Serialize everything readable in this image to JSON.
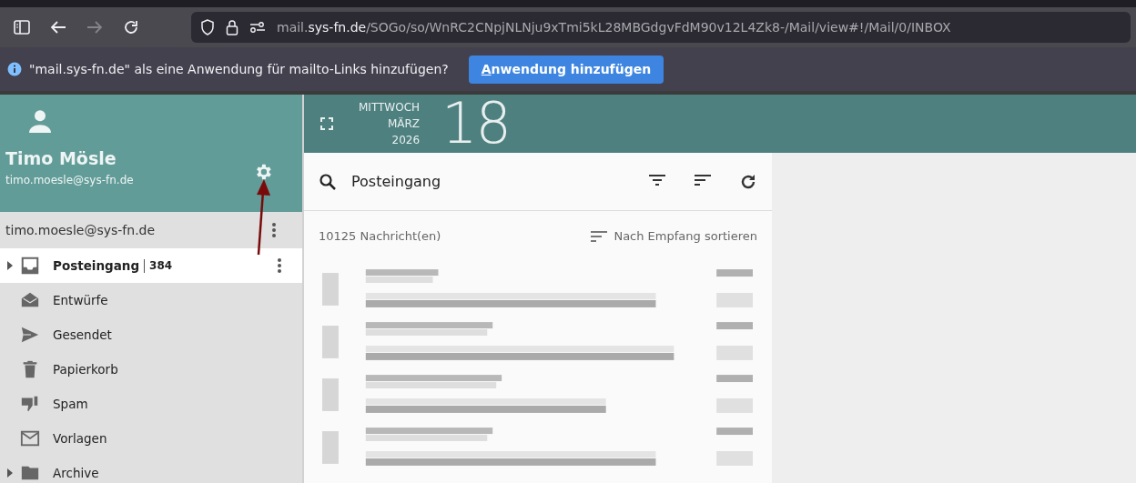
{
  "browser": {
    "url": {
      "host_prefix": "mail.",
      "domain": "sys-fn.de",
      "path": "/SOGo/so/WnRC2CNpjNLNju9xTmi5kL28MBGdgvFdM90v12L4Zk8-/Mail/view#!/Mail/0/INBOX"
    },
    "forward_disabled": true
  },
  "notification": {
    "text": "\"mail.sys-fn.de\" als eine Anwendung für mailto-Links hinzufügen?",
    "button": "Anwendung hinzufügen"
  },
  "user": {
    "name": "Timo Mösle",
    "email": "timo.moesle@sys-fn.de"
  },
  "account": {
    "label": "timo.moesle@sys-fn.de"
  },
  "folders": [
    {
      "kind": "inbox",
      "label": "Posteingang",
      "count": "384",
      "selected": true,
      "has_children": true
    },
    {
      "kind": "drafts",
      "label": "Entwürfe",
      "selected": false,
      "has_children": false
    },
    {
      "kind": "sent",
      "label": "Gesendet",
      "selected": false,
      "has_children": false
    },
    {
      "kind": "trash",
      "label": "Papierkorb",
      "selected": false,
      "has_children": false
    },
    {
      "kind": "spam",
      "label": "Spam",
      "selected": false,
      "has_children": false
    },
    {
      "kind": "templates",
      "label": "Vorlagen",
      "selected": false,
      "has_children": false
    },
    {
      "kind": "archive",
      "label": "Archive",
      "selected": false,
      "has_children": true
    }
  ],
  "date": {
    "weekday": "MITTWOCH",
    "month": "MÄRZ",
    "year": "2026",
    "day": "18"
  },
  "mailbox": {
    "title": "Posteingang",
    "count": "10125 Nachricht(en)",
    "sort": "Nach Empfang sortieren"
  },
  "messages": [
    {
      "kind": "pixelated"
    },
    {
      "kind": "pixelated"
    },
    {
      "kind": "pixelated"
    },
    {
      "kind": "pixelated"
    }
  ]
}
